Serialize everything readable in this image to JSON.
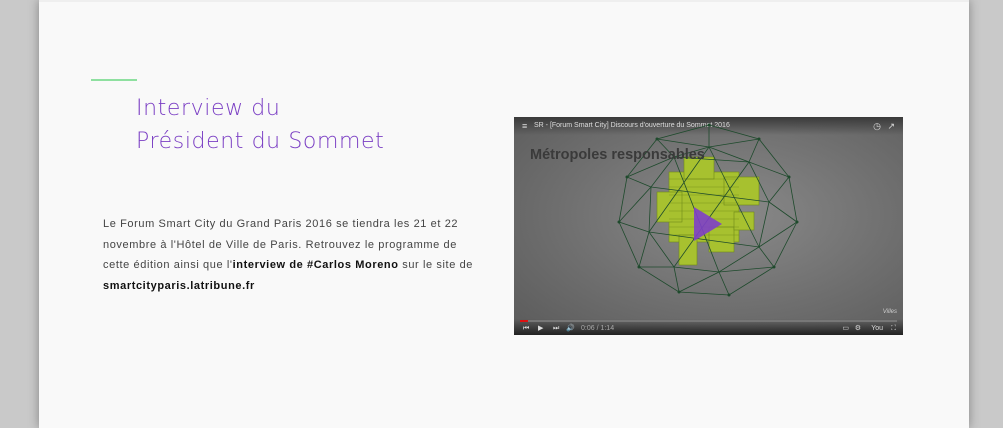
{
  "section": {
    "title_line1": "Interview du",
    "title_line2": "Président du Sommet",
    "body_part1": "Le Forum Smart City du Grand Paris 2016 se tiendra les 21 et 22 novembre à l'Hôtel de Ville de Paris. Retrouvez le programme de cette édition ainsi que l'",
    "body_bold1": "interview de #Carlos Moreno",
    "body_part2": " sur le site de ",
    "body_bold2": "smartcityparis.latribune.fr",
    "accent_color": "#8ee0a0",
    "title_color": "#7b3fc4"
  },
  "video": {
    "title": "SR - [Forum Smart City] Discours d'ouverture du Sommet 2016",
    "slide_heading": "Métropoles responsables",
    "time": "0:06 / 1:14",
    "progress": 0.02,
    "watermark": "Villes",
    "icons": {
      "menu": "≡",
      "clock": "◷",
      "share": "↗",
      "prev": "⏮",
      "play": "▶",
      "next": "⏭",
      "volume": "🔊",
      "cc": "▭",
      "settings": "⚙",
      "youtube": "You",
      "fullscreen": "⛶"
    }
  }
}
